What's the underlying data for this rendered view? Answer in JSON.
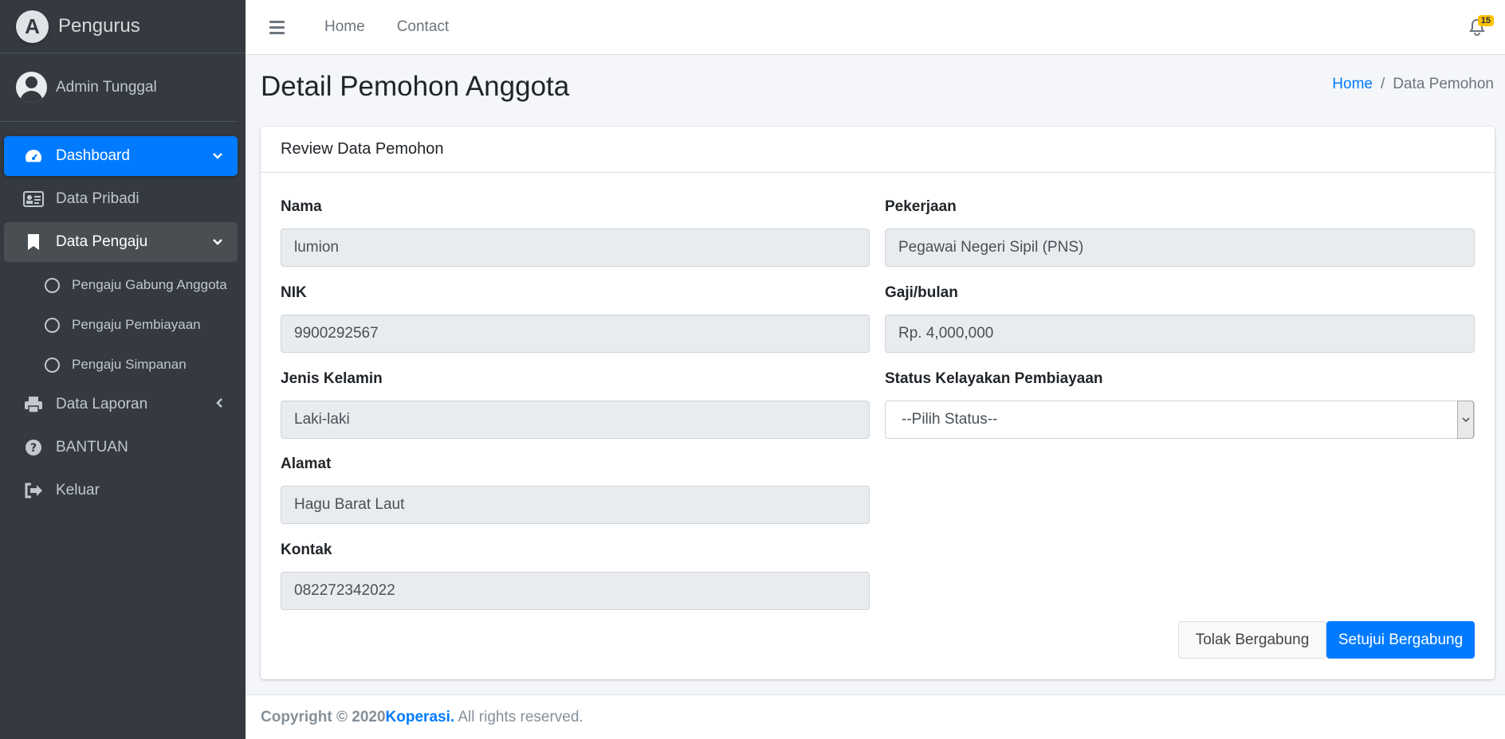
{
  "brand": {
    "name": "Pengurus",
    "logo_letter": "A"
  },
  "user": {
    "name": "Admin Tunggal"
  },
  "sidebar": {
    "items": [
      {
        "label": "Dashboard",
        "icon": "tachometer-icon",
        "state": "active",
        "arrow": "chevron-down"
      },
      {
        "label": "Data Pribadi",
        "icon": "id-card-icon"
      },
      {
        "label": "Data Pengaju",
        "icon": "bookmark-icon",
        "state": "open",
        "arrow": "chevron-down"
      },
      {
        "label": "Data Laporan",
        "icon": "print-icon",
        "arrow": "chevron-left"
      },
      {
        "label": "BANTUAN",
        "icon": "question-circle-icon"
      },
      {
        "label": "Keluar",
        "icon": "sign-out-icon"
      }
    ],
    "subitems": [
      {
        "label": "Pengaju Gabung Anggota"
      },
      {
        "label": "Pengaju Pembiayaan"
      },
      {
        "label": "Pengaju Simpanan"
      }
    ]
  },
  "topbar": {
    "links": [
      "Home",
      "Contact"
    ],
    "notification_count": "15"
  },
  "header": {
    "title": "Detail Pemohon Anggota",
    "breadcrumb": {
      "home": "Home",
      "separator": "/",
      "current": "Data Pemohon"
    }
  },
  "card": {
    "title": "Review Data Pemohon",
    "fields": {
      "nama": {
        "label": "Nama",
        "value": "lumion"
      },
      "nik": {
        "label": "NIK",
        "value": "9900292567"
      },
      "jenis_kelamin": {
        "label": "Jenis Kelamin",
        "value": "Laki-laki"
      },
      "alamat": {
        "label": "Alamat",
        "value": "Hagu Barat Laut"
      },
      "kontak": {
        "label": "Kontak",
        "value": "082272342022"
      },
      "pekerjaan": {
        "label": "Pekerjaan",
        "value": "Pegawai Negeri Sipil (PNS)"
      },
      "gaji": {
        "label": "Gaji/bulan",
        "value": "Rp. 4,000,000"
      },
      "status": {
        "label": "Status Kelayakan Pembiayaan",
        "value": "--Pilih Status--"
      }
    },
    "buttons": {
      "reject": "Tolak Bergabung",
      "approve": "Setujui Bergabung"
    }
  },
  "footer": {
    "prefix": "Copyright © 2020",
    "brand": "Koperasi.",
    "suffix": " All rights reserved."
  },
  "colors": {
    "sidebar": "#343a40",
    "primary": "#007bff",
    "badge": "#ffc107"
  }
}
